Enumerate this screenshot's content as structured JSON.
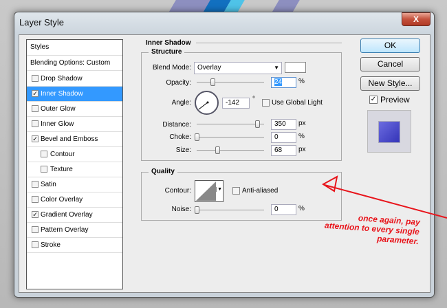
{
  "window": {
    "title": "Layer Style",
    "close": "X"
  },
  "styles_list": [
    {
      "label": "Styles",
      "type": "header"
    },
    {
      "label": "Blending Options: Custom",
      "type": "header"
    },
    {
      "label": "Drop Shadow",
      "checked": false
    },
    {
      "label": "Inner Shadow",
      "checked": true,
      "selected": true
    },
    {
      "label": "Outer Glow",
      "checked": false
    },
    {
      "label": "Inner Glow",
      "checked": false
    },
    {
      "label": "Bevel and Emboss",
      "checked": true
    },
    {
      "label": "Contour",
      "checked": false,
      "indent": true
    },
    {
      "label": "Texture",
      "checked": false,
      "indent": true
    },
    {
      "label": "Satin",
      "checked": false
    },
    {
      "label": "Color Overlay",
      "checked": false
    },
    {
      "label": "Gradient Overlay",
      "checked": true
    },
    {
      "label": "Pattern Overlay",
      "checked": false
    },
    {
      "label": "Stroke",
      "checked": false
    }
  ],
  "buttons": {
    "ok": "OK",
    "cancel": "Cancel",
    "new_style": "New Style...",
    "preview": "Preview",
    "preview_checked": true
  },
  "panel": {
    "title": "Inner Shadow",
    "structure": {
      "title": "Structure",
      "blend_mode_label": "Blend Mode:",
      "blend_mode": "Overlay",
      "color": "#ffffff",
      "opacity_label": "Opacity:",
      "opacity": "24",
      "opacity_unit": "%",
      "angle_label": "Angle:",
      "angle": "-142",
      "angle_unit": "°",
      "global_light": "Use Global Light",
      "distance_label": "Distance:",
      "distance": "350",
      "distance_unit": "px",
      "choke_label": "Choke:",
      "choke": "0",
      "choke_unit": "%",
      "size_label": "Size:",
      "size": "68",
      "size_unit": "px"
    },
    "quality": {
      "title": "Quality",
      "contour_label": "Contour:",
      "anti_aliased": "Anti-aliased",
      "noise_label": "Noise:",
      "noise": "0",
      "noise_unit": "%"
    }
  },
  "annotation": {
    "line1": "once again, pay",
    "line2": "attention to every single",
    "line3": "parameter.",
    "color": "#e8141b"
  }
}
